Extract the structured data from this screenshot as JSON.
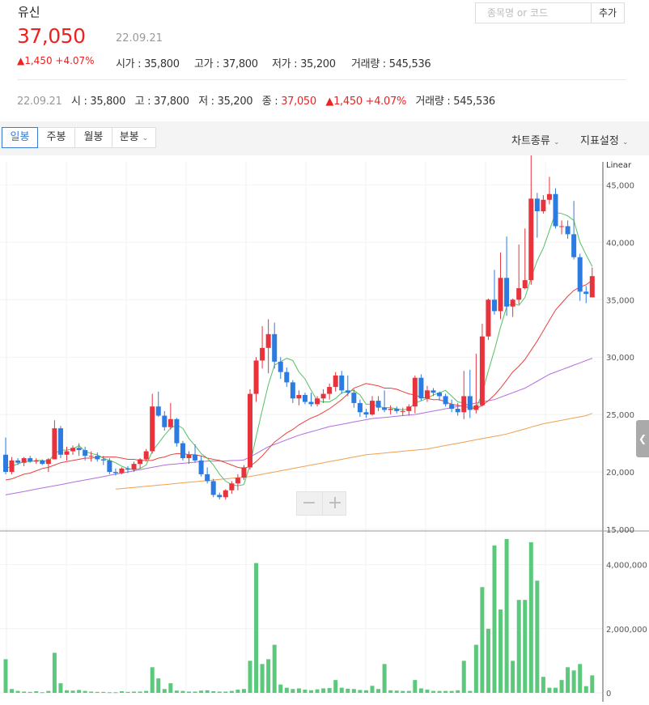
{
  "stock": {
    "name": "유신",
    "price": "37,050",
    "date": "22.09.21",
    "change": "▲1,450 +4.07%",
    "open": "시가 : 35,800",
    "high": "고가 : 37,800",
    "low": "저가 : 35,200",
    "volume": "거래량 : 545,536"
  },
  "search": {
    "placeholder": "종목명 or 코드",
    "add_label": "추가"
  },
  "summary": {
    "date": "22.09.21",
    "open": "시 : 35,800",
    "high": "고 : 37,800",
    "low": "저 : 35,200",
    "close_label": "종 : ",
    "close_value": "37,050",
    "change": "▲1,450 +4.07%",
    "volume": "거래량 : 545,536"
  },
  "toolbar": {
    "periods": [
      "일봉",
      "주봉",
      "월봉",
      "분봉"
    ],
    "active": "일봉",
    "chart_type": "차트종류",
    "indicator": "지표설정"
  },
  "zoom": {
    "minus": "−",
    "plus": "+"
  },
  "colors": {
    "up": "#e8323c",
    "down": "#2b7be0",
    "ma5": "#55c063",
    "ma20": "#e8423c",
    "ma60": "#b36ee0",
    "ma120": "#f0a050",
    "volume": "#5cc87c"
  },
  "chart_data": [
    {
      "type": "candlestick",
      "scale_label": "Linear",
      "ylim": [
        15000,
        47000
      ],
      "yticks": [
        "45,000",
        "40,000",
        "35,000",
        "30,000",
        "25,000",
        "20,000",
        "15,000"
      ],
      "ytick_values": [
        45000,
        40000,
        35000,
        30000,
        25000,
        20000,
        15000
      ],
      "candles": [
        [
          21500,
          23000,
          19800,
          20000
        ],
        [
          20000,
          21300,
          19800,
          21000
        ],
        [
          21000,
          21200,
          20600,
          20800
        ],
        [
          20800,
          21300,
          20500,
          21200
        ],
        [
          21200,
          21400,
          20800,
          20900
        ],
        [
          20900,
          21200,
          20700,
          21000
        ],
        [
          21000,
          21100,
          20600,
          20700
        ],
        [
          20700,
          21200,
          20000,
          21100
        ],
        [
          21100,
          24500,
          21100,
          23800
        ],
        [
          23800,
          24000,
          21200,
          21500
        ],
        [
          21500,
          22200,
          21000,
          21800
        ],
        [
          21800,
          22300,
          21500,
          22100
        ],
        [
          22100,
          22500,
          21400,
          21900
        ],
        [
          21900,
          22200,
          21000,
          21400
        ],
        [
          21400,
          21800,
          20900,
          21400
        ],
        [
          21400,
          21700,
          20900,
          21100
        ],
        [
          21100,
          21400,
          20600,
          21000
        ],
        [
          21000,
          21200,
          19800,
          20000
        ],
        [
          20000,
          20300,
          19700,
          19900
        ],
        [
          19900,
          20400,
          19800,
          20300
        ],
        [
          20300,
          20500,
          19900,
          20200
        ],
        [
          20200,
          20900,
          20000,
          20700
        ],
        [
          20700,
          21200,
          20300,
          21100
        ],
        [
          21100,
          22000,
          20900,
          21800
        ],
        [
          21800,
          26800,
          21600,
          25700
        ],
        [
          25700,
          27000,
          24800,
          24900
        ],
        [
          24900,
          25300,
          23600,
          23900
        ],
        [
          23900,
          26000,
          23700,
          24600
        ],
        [
          24600,
          24700,
          22200,
          22500
        ],
        [
          22500,
          22700,
          21000,
          21200
        ],
        [
          21200,
          21800,
          20700,
          21500
        ],
        [
          21500,
          22400,
          20800,
          21000
        ],
        [
          21000,
          21400,
          19600,
          19800
        ],
        [
          19800,
          20400,
          19000,
          19200
        ],
        [
          19200,
          19400,
          17800,
          18000
        ],
        [
          18000,
          18200,
          17600,
          17800
        ],
        [
          17800,
          18500,
          17600,
          18400
        ],
        [
          18400,
          19200,
          18100,
          19000
        ],
        [
          19000,
          19800,
          18400,
          19500
        ],
        [
          19500,
          20600,
          19300,
          20400
        ],
        [
          20400,
          27200,
          20200,
          26800
        ],
        [
          26800,
          30000,
          26100,
          29700
        ],
        [
          29700,
          32700,
          29000,
          30800
        ],
        [
          30800,
          33300,
          28600,
          32000
        ],
        [
          32000,
          33000,
          29000,
          29600
        ],
        [
          29600,
          30000,
          28100,
          28700
        ],
        [
          28700,
          29100,
          27400,
          27800
        ],
        [
          27800,
          28000,
          26000,
          26400
        ],
        [
          26400,
          27100,
          25800,
          26700
        ],
        [
          26700,
          26900,
          25900,
          26100
        ],
        [
          26100,
          26900,
          25700,
          25900
        ],
        [
          25900,
          26600,
          25700,
          26400
        ],
        [
          26400,
          27200,
          26000,
          26800
        ],
        [
          26800,
          27700,
          26300,
          27400
        ],
        [
          27400,
          28700,
          27000,
          28400
        ],
        [
          28400,
          28800,
          26800,
          27100
        ],
        [
          27100,
          28400,
          26600,
          26900
        ],
        [
          26900,
          27200,
          25600,
          26000
        ],
        [
          26000,
          26300,
          24800,
          25200
        ],
        [
          25200,
          25500,
          24700,
          25000
        ],
        [
          25000,
          26600,
          24900,
          26200
        ],
        [
          26200,
          26600,
          25300,
          25600
        ],
        [
          25600,
          27100,
          25200,
          25400
        ],
        [
          25400,
          25800,
          25000,
          25500
        ],
        [
          25500,
          25700,
          25100,
          25300
        ],
        [
          25300,
          25600,
          24900,
          25300
        ],
        [
          25300,
          25900,
          24900,
          25700
        ],
        [
          25700,
          28400,
          25100,
          28200
        ],
        [
          28200,
          28500,
          26200,
          26400
        ],
        [
          26400,
          27500,
          26100,
          27100
        ],
        [
          27100,
          27300,
          26600,
          26900
        ],
        [
          26900,
          27000,
          26200,
          26600
        ],
        [
          26600,
          26800,
          25700,
          25900
        ],
        [
          25900,
          26300,
          25200,
          25500
        ],
        [
          25500,
          26000,
          24900,
          25200
        ],
        [
          25200,
          28800,
          24600,
          26600
        ],
        [
          26600,
          28900,
          24700,
          25400
        ],
        [
          25400,
          30300,
          25100,
          25800
        ],
        [
          25800,
          32900,
          25700,
          31800
        ],
        [
          31800,
          35100,
          31500,
          35000
        ],
        [
          35000,
          37600,
          33700,
          34000
        ],
        [
          34000,
          39100,
          33300,
          36900
        ],
        [
          36900,
          40500,
          33600,
          34400
        ],
        [
          34400,
          35100,
          33500,
          35000
        ],
        [
          35000,
          39800,
          34600,
          36000
        ],
        [
          36000,
          41200,
          35900,
          36700
        ],
        [
          36700,
          47600,
          36300,
          43800
        ],
        [
          43800,
          44300,
          40400,
          42700
        ],
        [
          42700,
          44100,
          42500,
          43700
        ],
        [
          43700,
          45700,
          43300,
          44200
        ],
        [
          44200,
          44700,
          41200,
          41400
        ],
        [
          41400,
          41900,
          40700,
          41400
        ],
        [
          41400,
          41900,
          40300,
          40700
        ],
        [
          40700,
          43600,
          38500,
          38700
        ],
        [
          38700,
          39000,
          34900,
          35700
        ],
        [
          35700,
          36200,
          34700,
          35500
        ],
        [
          35200,
          37800,
          35200,
          37050
        ]
      ],
      "ma5": [
        20300,
        20500,
        20700,
        20900,
        20900,
        21000,
        21000,
        20900,
        21600,
        21900,
        21900,
        22000,
        22300,
        21800,
        21600,
        21500,
        21200,
        21000,
        20800,
        20500,
        20300,
        20200,
        20300,
        20600,
        21800,
        22500,
        23200,
        23800,
        24100,
        23800,
        22900,
        22300,
        21600,
        21200,
        20600,
        19800,
        19200,
        18900,
        18800,
        18900,
        20600,
        23100,
        25400,
        27600,
        29300,
        29600,
        29900,
        29700,
        28700,
        28100,
        27100,
        26200,
        26100,
        26100,
        26400,
        26900,
        27000,
        27100,
        26700,
        25900,
        25900,
        25700,
        25600,
        25600,
        25500,
        25400,
        25500,
        26000,
        26200,
        26400,
        26700,
        26900,
        27100,
        26600,
        26100,
        26000,
        25700,
        25600,
        26800,
        28800,
        30600,
        32600,
        34400,
        34700,
        34500,
        35200,
        36900,
        38400,
        39500,
        41000,
        42600,
        42500,
        42300,
        41900,
        40000,
        38900,
        37900
      ],
      "ma20": [
        19300,
        19400,
        19600,
        19800,
        19900,
        20100,
        20300,
        20400,
        20600,
        20800,
        20900,
        21000,
        21100,
        21200,
        21200,
        21300,
        21300,
        21300,
        21300,
        21200,
        21100,
        21100,
        21000,
        21000,
        21000,
        21200,
        21300,
        21500,
        21600,
        21600,
        21500,
        21500,
        21400,
        21200,
        21100,
        21000,
        20800,
        20600,
        20400,
        20300,
        20500,
        20900,
        21400,
        22000,
        22600,
        23000,
        23400,
        23700,
        24100,
        24400,
        24700,
        24900,
        25200,
        25500,
        25900,
        26300,
        26800,
        27300,
        27500,
        27700,
        27600,
        27500,
        27300,
        27300,
        27200,
        27000,
        26800,
        26700,
        26500,
        26400,
        26300,
        26300,
        26100,
        25900,
        25800,
        25700,
        25600,
        25500,
        25800,
        26200,
        26700,
        27300,
        28000,
        28700,
        29200,
        29800,
        30600,
        31400,
        32300,
        33200,
        34100,
        34700,
        35300,
        35800,
        36100,
        36300,
        36700
      ],
      "ma60": [
        18000,
        18100,
        18200,
        18300,
        18400,
        18500,
        18600,
        18700,
        18800,
        18900,
        19000,
        19100,
        19200,
        19300,
        19400,
        19500,
        19600,
        19700,
        19800,
        19900,
        20000,
        20100,
        20200,
        20300,
        20400,
        20500,
        20600,
        20650,
        20700,
        20750,
        20800,
        20850,
        20900,
        20950,
        20950,
        20950,
        20950,
        21000,
        21000,
        21050,
        21300,
        21600,
        21900,
        22200,
        22400,
        22600,
        22800,
        23000,
        23200,
        23350,
        23500,
        23650,
        23800,
        23950,
        24050,
        24150,
        24250,
        24350,
        24450,
        24550,
        24650,
        24700,
        24750,
        24800,
        24850,
        24900,
        24950,
        25000,
        25100,
        25200,
        25300,
        25400,
        25500,
        25600,
        25700,
        25800,
        25900,
        26000,
        26100,
        26200,
        26300,
        26500,
        26700,
        26900,
        27100,
        27300,
        27600,
        27900,
        28200,
        28500,
        28700,
        28900,
        29100,
        29300,
        29500,
        29700,
        29900
      ],
      "ma120": [
        null,
        null,
        null,
        null,
        null,
        null,
        null,
        null,
        null,
        null,
        null,
        null,
        null,
        null,
        null,
        null,
        null,
        null,
        18500,
        18550,
        18600,
        18650,
        18700,
        18750,
        18800,
        18850,
        18900,
        18950,
        19000,
        19050,
        19100,
        19150,
        19200,
        19250,
        19300,
        19350,
        19400,
        19450,
        19500,
        19550,
        19600,
        19700,
        19800,
        19900,
        20000,
        20100,
        20200,
        20300,
        20400,
        20500,
        20600,
        20700,
        20800,
        20900,
        21000,
        21100,
        21200,
        21300,
        21400,
        21500,
        21550,
        21600,
        21650,
        21700,
        21750,
        21800,
        21850,
        21900,
        21950,
        22000,
        22100,
        22200,
        22300,
        22400,
        22500,
        22600,
        22700,
        22800,
        22900,
        23000,
        23100,
        23200,
        23300,
        23450,
        23600,
        23750,
        23900,
        24050,
        24200,
        24300,
        24400,
        24500,
        24600,
        24700,
        24800,
        24900,
        25100
      ]
    },
    {
      "type": "bar",
      "ylim": [
        0,
        5000000
      ],
      "yticks": [
        "4,000,000",
        "2,000,000",
        "0"
      ],
      "ytick_values": [
        4000000,
        2000000,
        0
      ],
      "values": [
        1050000,
        120000,
        60000,
        40000,
        30000,
        50000,
        20000,
        60000,
        1250000,
        300000,
        80000,
        70000,
        90000,
        60000,
        40000,
        30000,
        30000,
        20000,
        20000,
        50000,
        30000,
        40000,
        40000,
        60000,
        800000,
        450000,
        120000,
        300000,
        70000,
        60000,
        40000,
        40000,
        70000,
        80000,
        50000,
        40000,
        40000,
        60000,
        100000,
        120000,
        1000000,
        4050000,
        900000,
        1050000,
        1500000,
        260000,
        160000,
        120000,
        140000,
        100000,
        80000,
        110000,
        140000,
        150000,
        400000,
        160000,
        130000,
        120000,
        90000,
        80000,
        220000,
        120000,
        900000,
        80000,
        70000,
        60000,
        60000,
        400000,
        140000,
        100000,
        60000,
        60000,
        60000,
        60000,
        80000,
        1000000,
        60000,
        1500000,
        3300000,
        2000000,
        4600000,
        2600000,
        4800000,
        1000000,
        2900000,
        2900000,
        4700000,
        3500000,
        500000,
        160000,
        160000,
        400000,
        800000,
        700000,
        900000,
        210000,
        545536
      ]
    }
  ]
}
